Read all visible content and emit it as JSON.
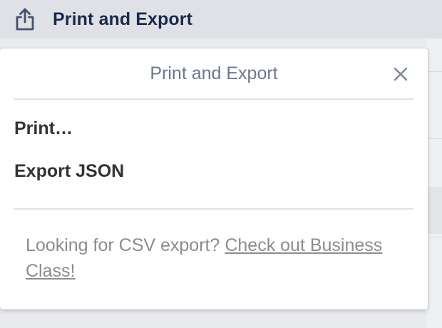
{
  "header": {
    "title": "Print and Export",
    "icon": "share-export-icon"
  },
  "popover": {
    "title": "Print and Export",
    "close_icon": "close-icon",
    "items": [
      {
        "label": "Print…"
      },
      {
        "label": "Export JSON"
      }
    ],
    "footer": {
      "prefix": "Looking for CSV export? ",
      "link_label": "Check out Business Class!"
    }
  },
  "colors": {
    "header_background": "#dfe1e6",
    "header_text": "#172b4d",
    "popover_title": "#6b778c",
    "footer_text": "#8c8c8c"
  }
}
